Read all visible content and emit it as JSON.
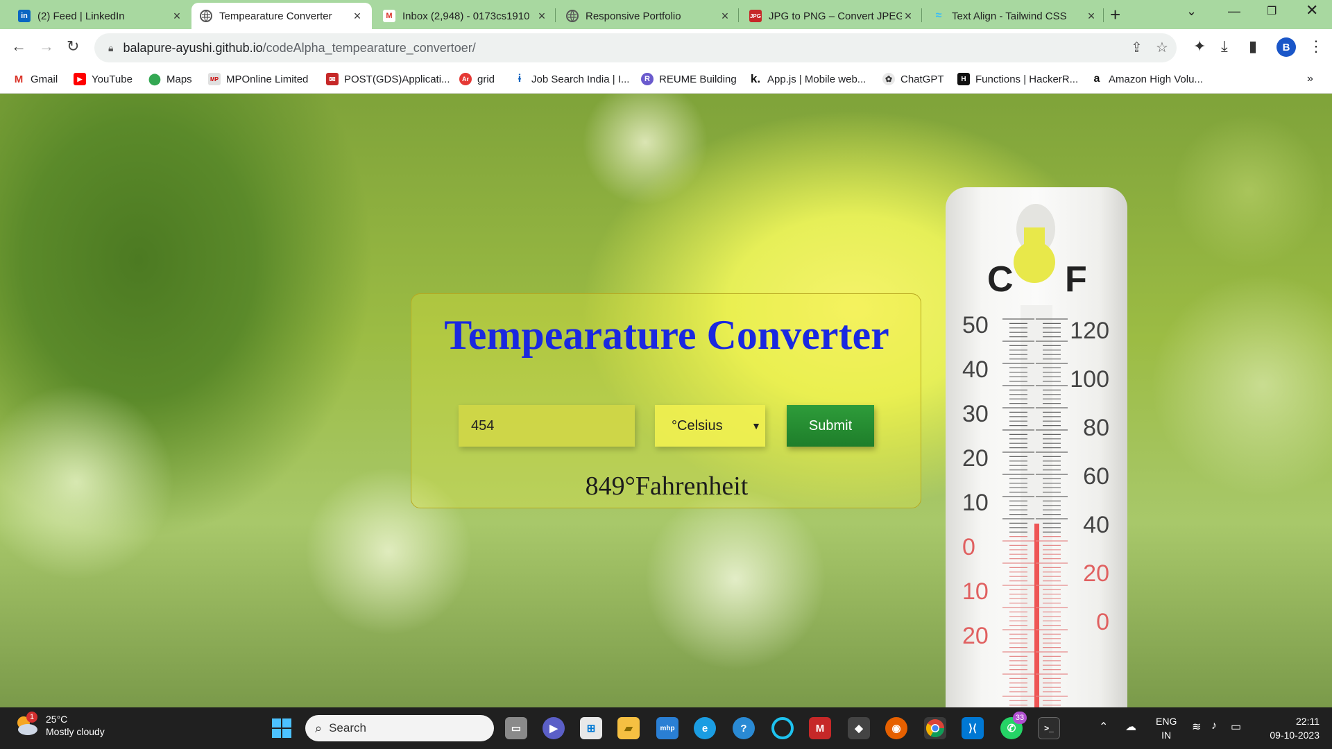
{
  "tabs": [
    {
      "title": "(2) Feed | LinkedIn",
      "icon": "linkedin-icon",
      "color": "#0a66c2"
    },
    {
      "title": "Tempearature Converter",
      "icon": "globe-icon",
      "color": "#555555"
    },
    {
      "title": "Inbox (2,948) - 0173cs1910",
      "icon": "gmail-icon",
      "color": "#d93025"
    },
    {
      "title": "Responsive Portfolio",
      "icon": "globe-icon",
      "color": "#555555"
    },
    {
      "title": "JPG to PNG – Convert JPEG",
      "icon": "jpg-png-icon",
      "color": "#c62828"
    },
    {
      "title": "Text Align - Tailwind CSS",
      "icon": "tailwind-icon",
      "color": "#38bdf8"
    }
  ],
  "address": {
    "host": "balapure-ayushi.github.io",
    "path": "/codeAlpha_tempearature_convertoer/"
  },
  "bookmarks": [
    {
      "label": "Gmail",
      "icon": "gmail-icon"
    },
    {
      "label": "YouTube",
      "icon": "youtube-icon"
    },
    {
      "label": "Maps",
      "icon": "maps-icon"
    },
    {
      "label": "MPOnline Limited",
      "icon": "mponline-icon"
    },
    {
      "label": "POST(GDS)Applicati...",
      "icon": "indiapost-icon"
    },
    {
      "label": "grid",
      "icon": "grid-icon"
    },
    {
      "label": "Job Search India | I...",
      "icon": "jobsearch-icon"
    },
    {
      "label": "REUME Building",
      "icon": "resume-icon"
    },
    {
      "label": "App.js | Mobile web...",
      "icon": "appjs-icon"
    },
    {
      "label": "ChatGPT",
      "icon": "chatgpt-icon"
    },
    {
      "label": "Functions | HackerR...",
      "icon": "hackerrank-icon"
    },
    {
      "label": "Amazon High Volu...",
      "icon": "amazon-icon"
    }
  ],
  "profile_initial": "B",
  "page": {
    "title": "Tempearature Converter",
    "input_value": "454",
    "unit_selected": "°Celsius",
    "submit_label": "Submit",
    "result": "849°Fahrenheit"
  },
  "thermometer": {
    "celsius_label": "C",
    "fahrenheit_label": "F",
    "celsius_ticks": [
      "50",
      "40",
      "30",
      "20",
      "10",
      "0",
      "10",
      "20"
    ],
    "fahrenheit_ticks": [
      "120",
      "100",
      "80",
      "60",
      "40",
      "20",
      "0"
    ]
  },
  "taskbar": {
    "weather_temp": "25°C",
    "weather_desc": "Mostly cloudy",
    "weather_badge": "1",
    "search_placeholder": "Search",
    "whatsapp_badge": "33",
    "lang_top": "ENG",
    "lang_bottom": "IN",
    "time": "22:11",
    "date": "09-10-2023"
  }
}
